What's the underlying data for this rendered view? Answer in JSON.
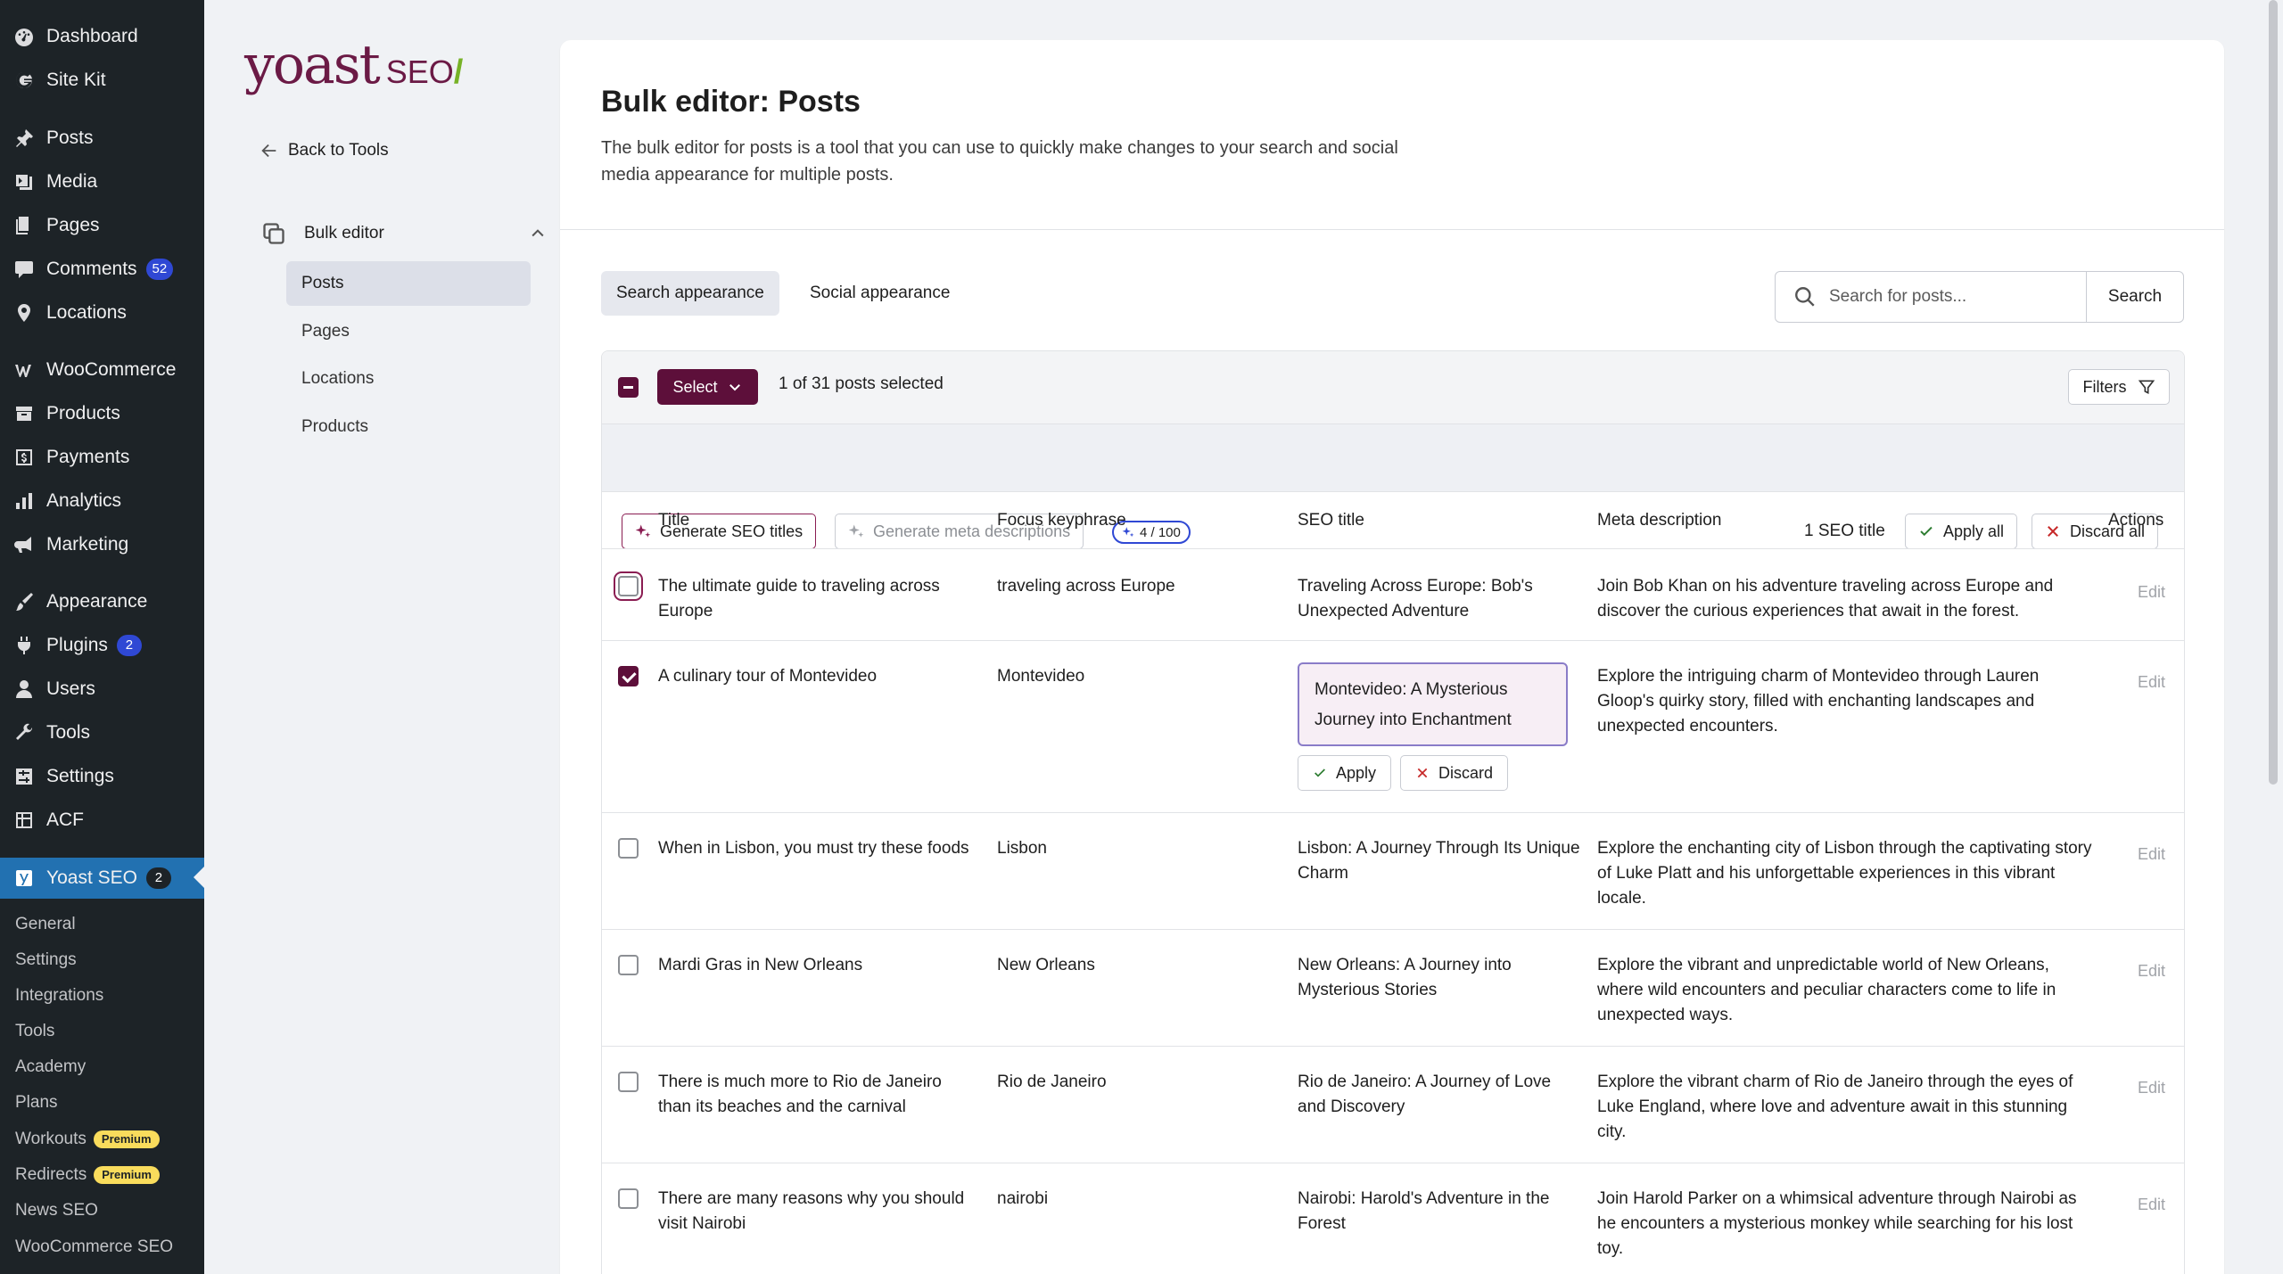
{
  "wp_menu": {
    "items": [
      {
        "label": "Dashboard",
        "icon": "dashboard-icon",
        "badge": ""
      },
      {
        "label": "Site Kit",
        "icon": "google-icon",
        "badge": ""
      },
      {
        "label": "Posts",
        "icon": "pin-icon",
        "badge": ""
      },
      {
        "label": "Media",
        "icon": "media-icon",
        "badge": ""
      },
      {
        "label": "Pages",
        "icon": "pages-icon",
        "badge": ""
      },
      {
        "label": "Comments",
        "icon": "comment-icon",
        "badge": "52"
      },
      {
        "label": "Locations",
        "icon": "location-icon",
        "badge": ""
      },
      {
        "label": "WooCommerce",
        "icon": "woocommerce-icon",
        "badge": ""
      },
      {
        "label": "Products",
        "icon": "products-icon",
        "badge": ""
      },
      {
        "label": "Payments",
        "icon": "payments-icon",
        "badge": ""
      },
      {
        "label": "Analytics",
        "icon": "analytics-icon",
        "badge": ""
      },
      {
        "label": "Marketing",
        "icon": "megaphone-icon",
        "badge": ""
      },
      {
        "label": "Appearance",
        "icon": "brush-icon",
        "badge": ""
      },
      {
        "label": "Plugins",
        "icon": "plugin-icon",
        "badge": "2"
      },
      {
        "label": "Users",
        "icon": "user-icon",
        "badge": ""
      },
      {
        "label": "Tools",
        "icon": "wrench-icon",
        "badge": ""
      },
      {
        "label": "Settings",
        "icon": "settings-icon",
        "badge": ""
      },
      {
        "label": "ACF",
        "icon": "acf-icon",
        "badge": ""
      }
    ],
    "active": {
      "label": "Yoast SEO",
      "icon": "yoast-icon",
      "badge": "2"
    },
    "submenu": [
      {
        "label": "General",
        "tag": ""
      },
      {
        "label": "Settings",
        "tag": ""
      },
      {
        "label": "Integrations",
        "tag": ""
      },
      {
        "label": "Tools",
        "tag": ""
      },
      {
        "label": "Academy",
        "tag": ""
      },
      {
        "label": "Plans",
        "tag": ""
      },
      {
        "label": "Workouts",
        "tag": "Premium"
      },
      {
        "label": "Redirects",
        "tag": "Premium"
      },
      {
        "label": "News SEO",
        "tag": ""
      },
      {
        "label": "WooCommerce SEO",
        "tag": ""
      }
    ]
  },
  "yoast_nav": {
    "logo_main": "yoast",
    "logo_seo": "SEO",
    "logo_slash": "/",
    "back_label": "Back to Tools",
    "section_label": "Bulk editor",
    "items": [
      "Posts",
      "Pages",
      "Locations",
      "Products"
    ]
  },
  "page": {
    "title": "Bulk editor: Posts",
    "description": "The bulk editor for posts is a tool that you can use to quickly make changes to your search and social media appearance for multiple posts."
  },
  "tabs": [
    "Search appearance",
    "Social appearance"
  ],
  "search": {
    "placeholder": "Search for posts...",
    "button": "Search"
  },
  "toolbar": {
    "select_label": "Select",
    "selection_text": "1 of 31 posts selected",
    "filters_label": "Filters",
    "gen_titles": "Generate SEO titles",
    "gen_meta": "Generate meta descriptions",
    "sparks": "4 / 100",
    "seo_count": "1 SEO title",
    "apply_all": "Apply all",
    "discard_all": "Discard all"
  },
  "table": {
    "headers": [
      "Title",
      "Focus keyphrase",
      "SEO title",
      "Meta description",
      "Actions"
    ],
    "edit_label": "Edit",
    "apply_label": "Apply",
    "discard_label": "Discard",
    "rows": [
      {
        "title": "The ultimate guide to traveling across Europe",
        "keyphrase": "traveling across Europe",
        "seo_title": "Traveling Across Europe: Bob's Unexpected Adventure",
        "meta": "Join Bob Khan on his adventure traveling across Europe and discover the curious experiences that await in the forest."
      },
      {
        "title": "A culinary tour of Montevideo",
        "keyphrase": "Montevideo",
        "seo_title": "Montevideo: A Mysterious Journey into Enchantment",
        "meta": "Explore the intriguing charm of Montevideo through Lauren Gloop's quirky story, filled with enchanting landscapes and unexpected encounters."
      },
      {
        "title": "When in Lisbon, you must try these foods",
        "keyphrase": "Lisbon",
        "seo_title": "Lisbon: A Journey Through Its Unique Charm",
        "meta": "Explore the enchanting city of Lisbon through the captivating story of Luke Platt and his unforgettable experiences in this vibrant locale."
      },
      {
        "title": "Mardi Gras in New Orleans",
        "keyphrase": "New Orleans",
        "seo_title": "New Orleans: A Journey into Mysterious Stories",
        "meta": "Explore the vibrant and unpredictable world of New Orleans, where wild encounters and peculiar characters come to life in unexpected ways."
      },
      {
        "title": "There is much more to Rio de Janeiro than its beaches and the carnival",
        "keyphrase": "Rio de Janeiro",
        "seo_title": "Rio de Janeiro: A Journey of Love and Discovery",
        "meta": "Explore the vibrant charm of Rio de Janeiro through the eyes of Luke England, where love and adventure await in this stunning city."
      },
      {
        "title": "There are many reasons why you should visit Nairobi",
        "keyphrase": "nairobi",
        "seo_title": "Nairobi: Harold's Adventure in the Forest",
        "meta": "Join Harold Parker on a whimsical adventure through Nairobi as he encounters a mysterious monkey while searching for his lost toy."
      }
    ]
  }
}
